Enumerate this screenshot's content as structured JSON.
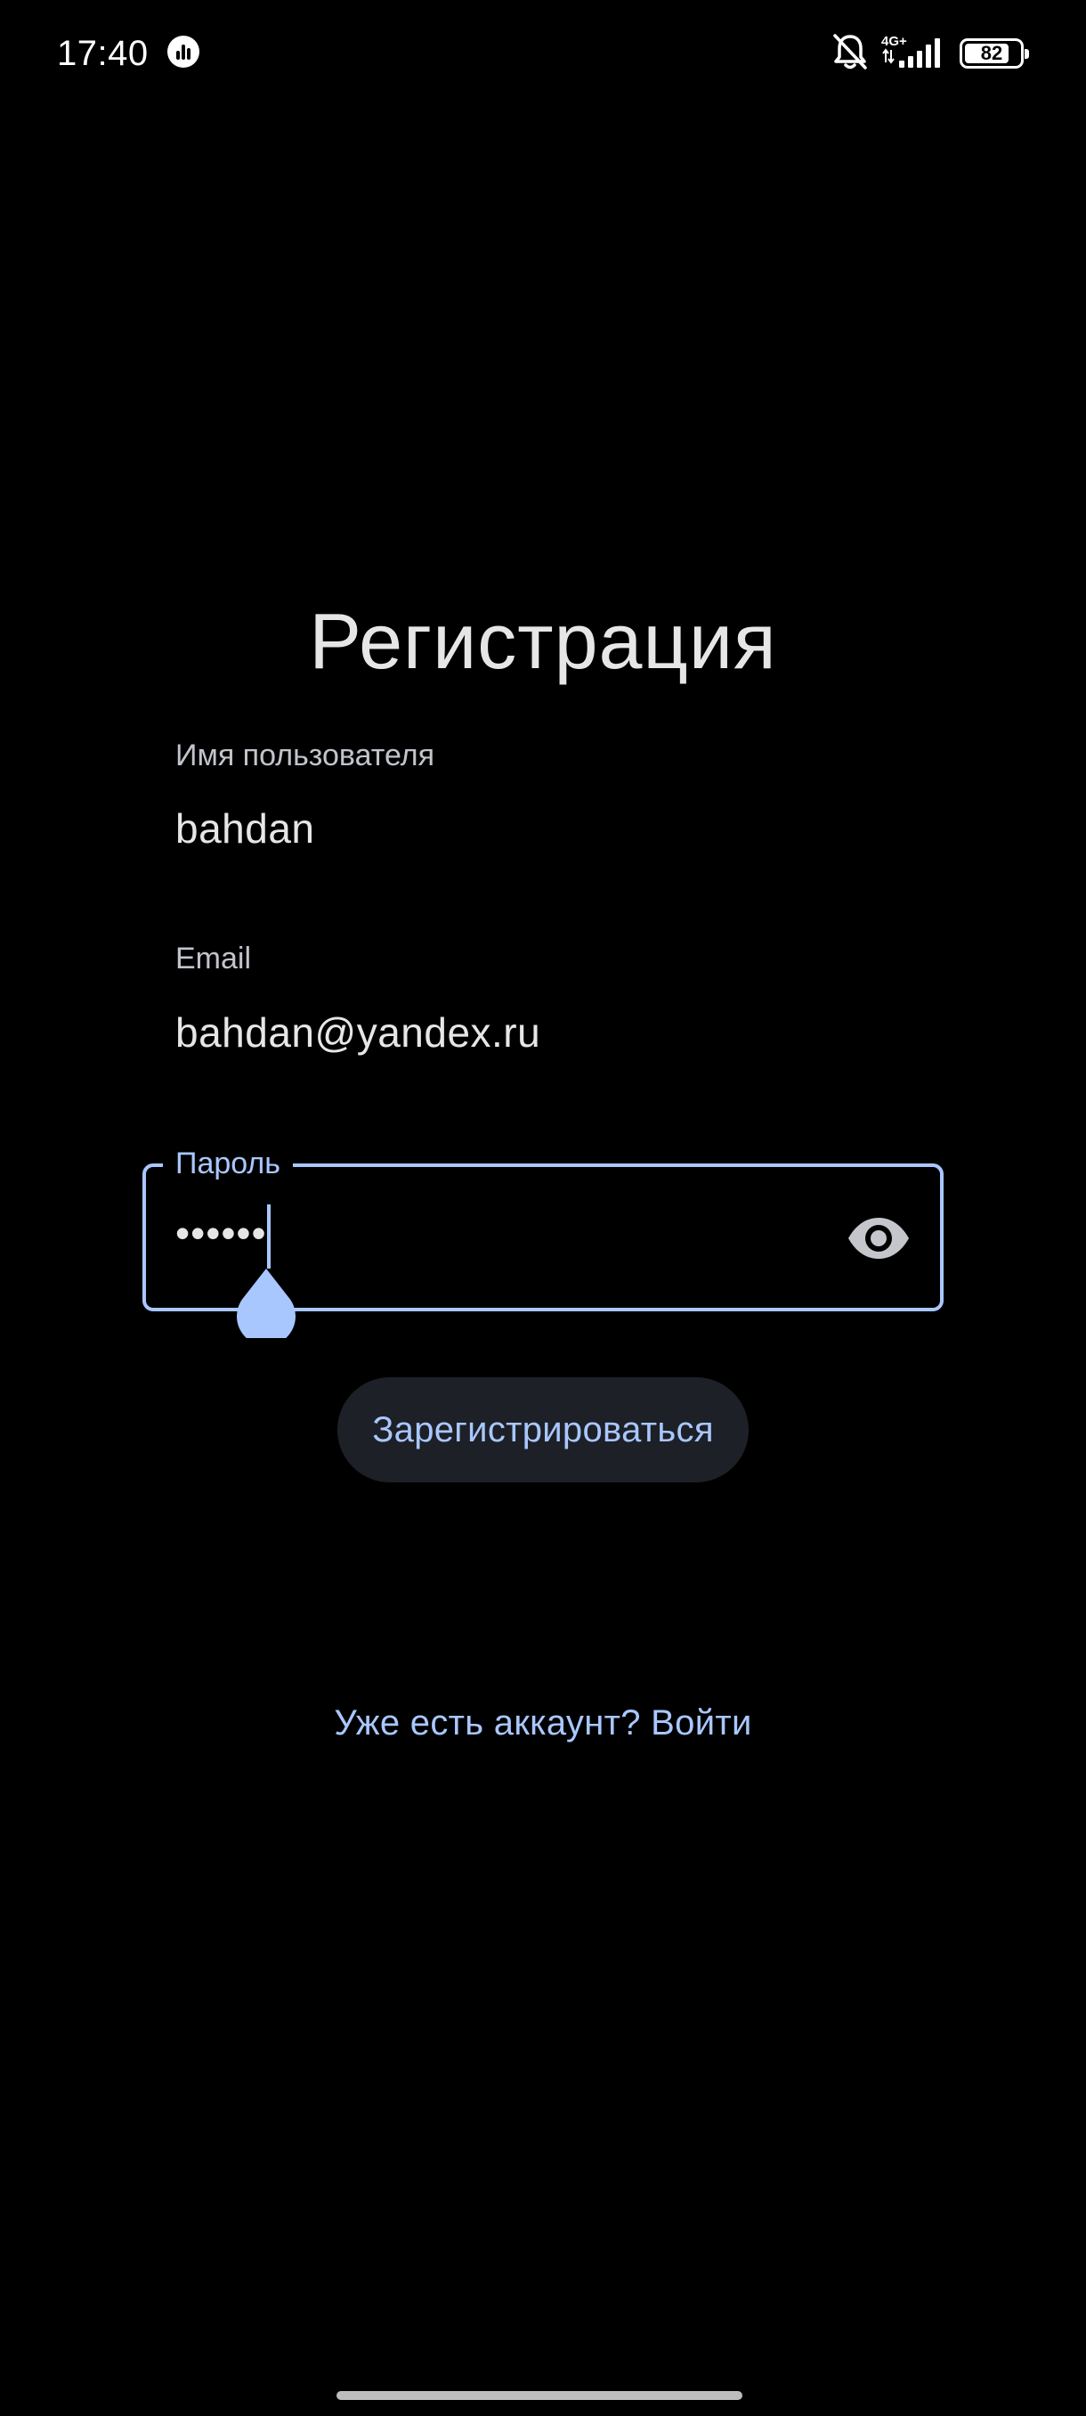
{
  "status_bar": {
    "time": "17:40",
    "network_type": "4G+",
    "battery_level": "82",
    "battery_percent": 82
  },
  "screen": {
    "title": "Регистрация"
  },
  "form": {
    "username": {
      "label": "Имя пользователя",
      "value": "bahdan"
    },
    "email": {
      "label": "Email",
      "value": "bahdan@yandex.ru"
    },
    "password": {
      "label": "Пароль",
      "value": "••••••",
      "visibility_icon": "eye-icon"
    },
    "submit_label": "Зарегистрироваться",
    "login_link": "Уже есть аккаунт? Войти"
  },
  "colors": {
    "accent": "#a9c7ff",
    "background": "#000000",
    "button_surface": "#1d2026",
    "text_primary": "#e6e6e6",
    "text_secondary": "#c2c4cc"
  },
  "icons": [
    "activity-icon",
    "bell-muted-icon",
    "signal-icon",
    "battery-icon",
    "eye-icon"
  ]
}
